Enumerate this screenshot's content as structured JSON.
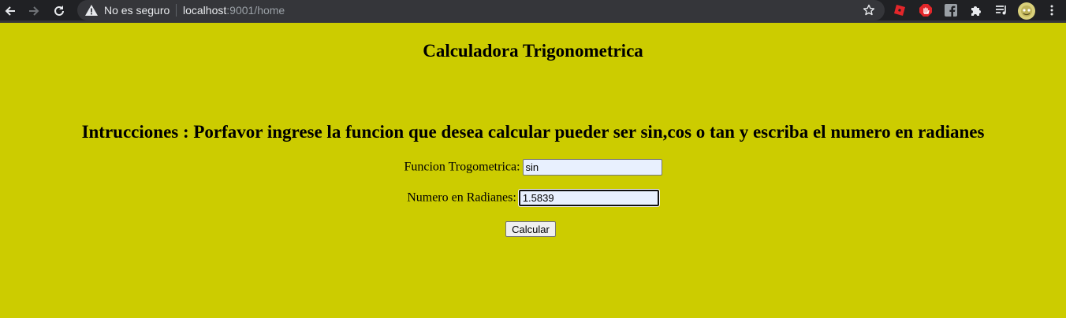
{
  "browser": {
    "security_label": "No es seguro",
    "url_host": "localhost",
    "url_path": ":9001/home"
  },
  "page": {
    "title": "Calculadora Trigonometrica",
    "instructions": "Intrucciones : Porfavor ingrese la funcion que desea calcular pueder ser sin,cos o tan y escriba el numero en radianes",
    "function_label": "Funcion Trogometrica:",
    "function_value": "sin",
    "radians_label": "Numero en Radianes:",
    "radians_value": "1.5839",
    "calculate_label": "Calcular"
  },
  "colors": {
    "page_background": "#cccc00",
    "chrome_background": "#202124"
  },
  "icons": [
    "back-arrow-icon",
    "forward-arrow-icon",
    "reload-icon",
    "warning-icon",
    "star-icon",
    "roblox-extension-icon",
    "adblock-icon",
    "facebook-extension-icon",
    "puzzle-extensions-icon",
    "media-playlist-icon",
    "profile-avatar",
    "kebab-menu-icon"
  ]
}
